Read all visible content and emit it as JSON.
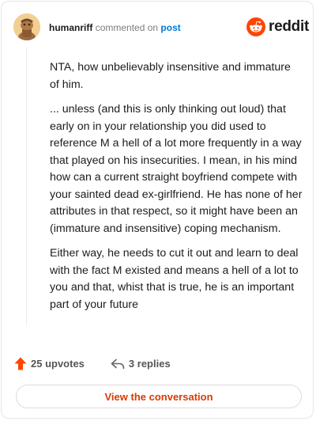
{
  "header": {
    "username": "humanriff",
    "action": "commented on",
    "post_link": "post",
    "brand": "reddit"
  },
  "comment": {
    "paragraphs": [
      "NTA, how unbelievably insensitive and immature of him.",
      "... unless (and this is only thinking out loud) that early on in your relationship you did used to reference M a hell of a lot more frequently in a way that played on his insecurities. I mean, in his mind how can a current straight boyfriend compete with your sainted dead ex-girlfriend. He has none of her attributes in that respect, so it might have been an (immature and insensitive) coping mechanism.",
      "Either way, he needs to cut it out and learn to deal with the fact M existed and means a hell of a lot to you and that, whist that is true, he is an important part of your future"
    ]
  },
  "actions": {
    "upvotes": "25 upvotes",
    "replies": "3 replies"
  },
  "cta": {
    "view_conversation": "View the conversation"
  },
  "colors": {
    "brand": "#ff4500",
    "link": "#0079d3",
    "cta_text": "#d93a00"
  }
}
